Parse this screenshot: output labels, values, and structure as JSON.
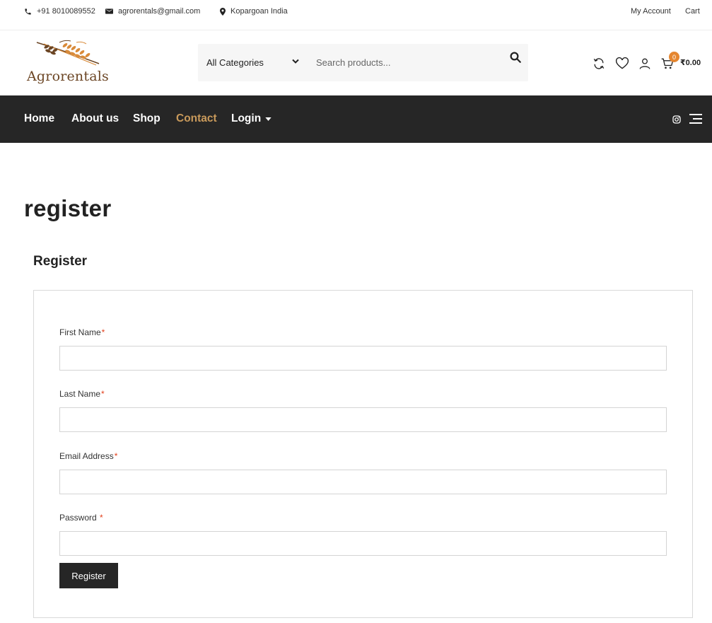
{
  "topbar": {
    "phone": "+91 8010089552",
    "email": "agrorentals@gmail.com",
    "location": "Kopargoan India",
    "my_account": "My Account",
    "cart": "Cart"
  },
  "header": {
    "logo_text": "Agrorentals",
    "category_selected": "All Categories",
    "search_placeholder": "Search products...",
    "cart_count": "0",
    "cart_total": "₹0.00"
  },
  "nav": {
    "items": [
      {
        "label": "Home"
      },
      {
        "label": "About us"
      },
      {
        "label": "Shop"
      },
      {
        "label": "Contact"
      },
      {
        "label": "Login"
      }
    ],
    "active_index": 3
  },
  "page": {
    "title": "register",
    "section_title": "Register"
  },
  "form": {
    "first_name_label": "First Name",
    "last_name_label": "Last Name",
    "email_label": "Email Address",
    "password_label": "Password ",
    "required_mark": "*",
    "first_name_value": "",
    "last_name_value": "",
    "email_value": "",
    "password_value": "",
    "submit_label": "Register"
  },
  "colors": {
    "nav_bg": "#262626",
    "accent": "#c99a5b",
    "badge": "#e5862f",
    "required": "#e2401c"
  }
}
